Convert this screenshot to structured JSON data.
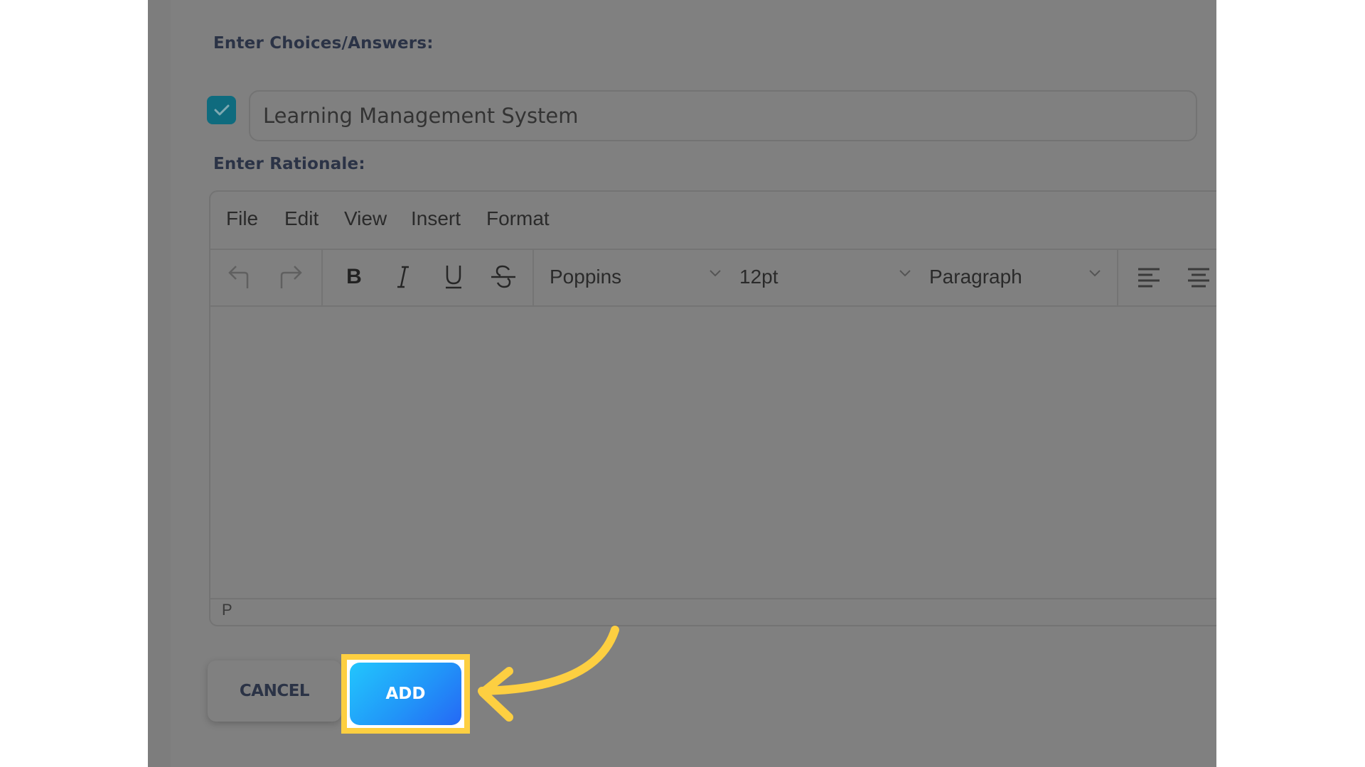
{
  "form": {
    "choices_label": "Enter Choices/Answers:",
    "choice": {
      "checked": true,
      "value": "Learning Management System"
    },
    "rationale_label": "Enter Rationale:"
  },
  "editor": {
    "menu": [
      "File",
      "Edit",
      "View",
      "Insert",
      "Format"
    ],
    "toolbar": {
      "font_family": "Poppins",
      "font_size": "12pt",
      "block_format": "Paragraph"
    },
    "content": "",
    "status_path": "P"
  },
  "actions": {
    "cancel_label": "CANCEL",
    "add_label": "ADD"
  },
  "annotation": {
    "highlight_color": "#fdcf41",
    "target": "add-button"
  },
  "colors": {
    "checkbox": "#0f6b7e",
    "add_gradient_start": "#22c6fd",
    "add_gradient_end": "#2568f5",
    "overlay": "#808080"
  }
}
